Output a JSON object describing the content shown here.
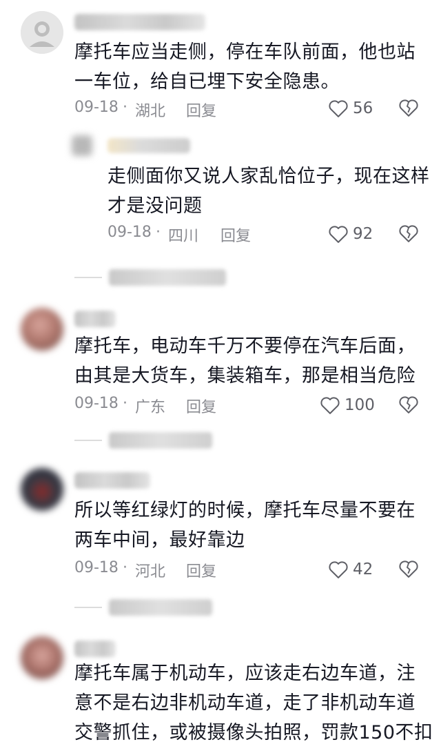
{
  "comments": [
    {
      "text": "摩托车应当走侧，停在车队前面，他也站\n一车位，给自已埋下安全隐患。",
      "date": "09-18",
      "sep": "·",
      "location": "湖北",
      "reply_label": "回复",
      "likes": "56"
    },
    {
      "text": "走侧面你又说人家乱恰位子，现在这样\n才是没问题",
      "date": "09-18",
      "sep": "·",
      "location": "四川",
      "reply_label": "回复",
      "likes": "92"
    },
    {
      "text": "摩托车，电动车千万不要停在汽车后面，\n由其是大货车，集装箱车，那是相当危险",
      "date": "09-18",
      "sep": "·",
      "location": "广东",
      "reply_label": "回复",
      "likes": "100"
    },
    {
      "text": "所以等红绿灯的时候，摩托车尽量不要在\n两车中间，最好靠边",
      "date": "09-18",
      "sep": "·",
      "location": "河北",
      "reply_label": "回复",
      "likes": "42"
    },
    {
      "text": "摩托车属于机动车，应该走右边车道，注\n意不是右边非机动车道，走了非机动车道\n交警抓住，或被摄像头拍照，罚款150不扣"
    }
  ],
  "colors": {
    "text": "#161823",
    "meta": "#8a8b91",
    "icon": "#5e5f66"
  },
  "icons": {
    "like": "heart-outline-icon",
    "dislike": "broken-heart-icon"
  }
}
